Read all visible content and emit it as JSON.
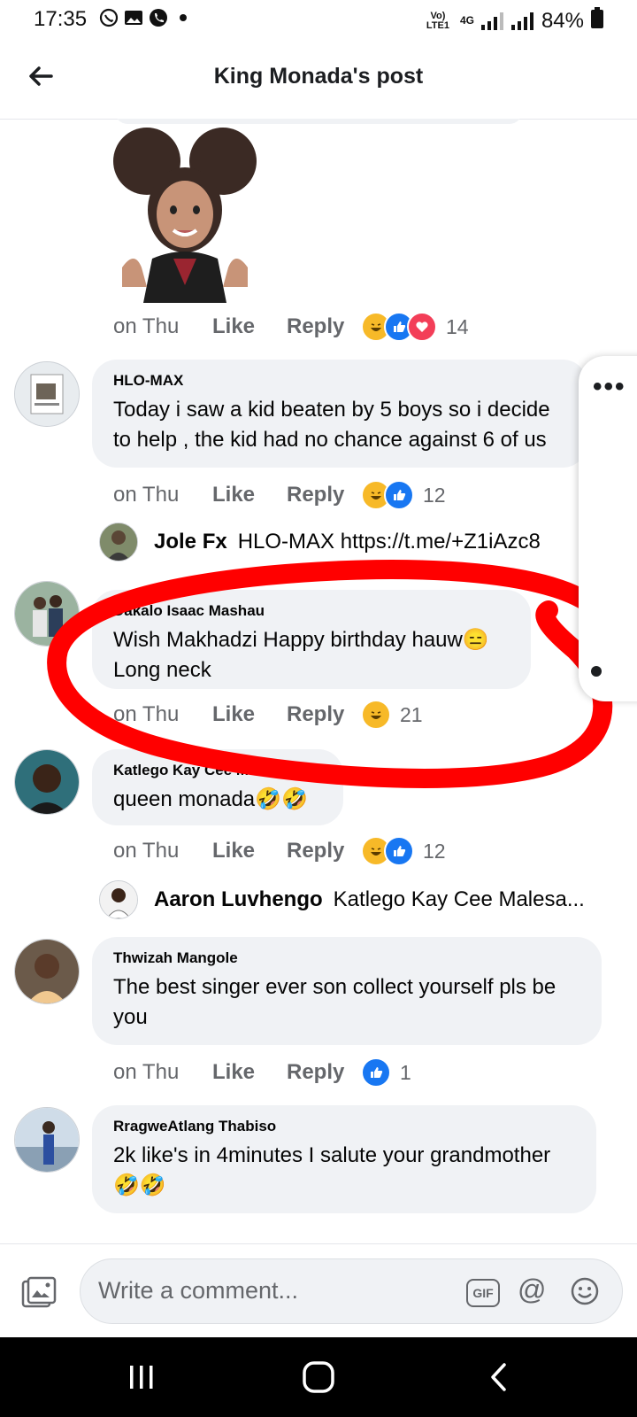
{
  "status_bar": {
    "time": "17:35",
    "network": "Vo) LTE1",
    "network_gen": "4G",
    "battery": "84%",
    "icons": [
      "whatsapp-icon",
      "gallery-icon",
      "phone-icon",
      "dot-icon"
    ]
  },
  "app_bar": {
    "back_icon": "arrow-left-icon",
    "title": "King Monada's post"
  },
  "comments": [
    {
      "sticker": "avatar-sticker-thumbs-up",
      "time": "on Thu",
      "like": "Like",
      "reply": "Reply",
      "reactions": [
        "haha",
        "like",
        "love"
      ],
      "reaction_count": "14"
    },
    {
      "author": "HLO-MAX",
      "text": "Today i saw a kid beaten by 5 boys so i decide\nto help , the kid had no chance against 6 of us",
      "time": "on Thu",
      "like": "Like",
      "reply": "Reply",
      "reactions": [
        "haha",
        "like"
      ],
      "reaction_count": "12",
      "reply_preview": {
        "name": "Jole Fx",
        "text": "HLO-MAX https://t.me/+Z1iAzc8"
      }
    },
    {
      "author": "Dakalo Isaac Mashau",
      "text": "Wish Makhadzi Happy birthday hauw😑\nLong neck",
      "time": "on Thu",
      "like": "Like",
      "reply": "Reply",
      "reactions": [
        "haha"
      ],
      "reaction_count": "21"
    },
    {
      "author": "Katlego Kay Cee Malesa",
      "text": "queen monada🤣🤣",
      "time": "on Thu",
      "like": "Like",
      "reply": "Reply",
      "reactions": [
        "haha",
        "like"
      ],
      "reaction_count": "12",
      "reply_preview": {
        "name": "Aaron Luvhengo",
        "text": "Katlego Kay Cee Malesa..."
      }
    },
    {
      "author": "Thwizah Mangole",
      "text": "The best singer ever son collect yourself pls be\nyou",
      "time": "on Thu",
      "like": "Like",
      "reply": "Reply",
      "reactions": [
        "like"
      ],
      "reaction_count": "1"
    },
    {
      "author": "RragweAtlang Thabiso",
      "text": "2k like's in 4minutes I salute your grandmother\n🤣🤣"
    }
  ],
  "composer": {
    "placeholder": "Write a comment...",
    "gif_label": "GIF",
    "at_label": "@"
  },
  "colors": {
    "bubble": "#f0f2f5",
    "secondary_text": "#65676b",
    "like_blue": "#1877f2",
    "love_red": "#f33e58",
    "haha_yellow": "#f7b928",
    "annotation_red": "#ff0000"
  }
}
